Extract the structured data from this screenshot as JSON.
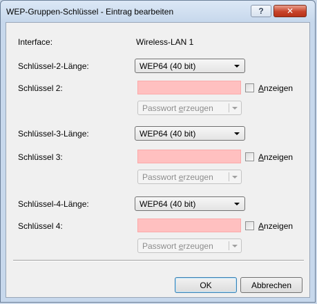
{
  "window": {
    "title": "WEP-Gruppen-Schlüssel - Eintrag bearbeiten",
    "help_label": "?",
    "close_label": "✕"
  },
  "interface": {
    "label": "Interface:",
    "value": "Wireless-LAN 1"
  },
  "groups": [
    {
      "length_label": "Schlüssel-2-Länge:",
      "length_value": "WEP64 (40 bit)",
      "key_label": "Schlüssel 2:",
      "key_value": "",
      "show_label_pre": "",
      "show_label_accel": "A",
      "show_label_post": "nzeigen",
      "generate_pre": "Passwort ",
      "generate_accel": "e",
      "generate_post": "rzeugen"
    },
    {
      "length_label": "Schlüssel-3-Länge:",
      "length_value": "WEP64 (40 bit)",
      "key_label": "Schlüssel 3:",
      "key_value": "",
      "show_label_pre": "",
      "show_label_accel": "A",
      "show_label_post": "nzeigen",
      "generate_pre": "Passwort ",
      "generate_accel": "e",
      "generate_post": "rzeugen"
    },
    {
      "length_label": "Schlüssel-4-Länge:",
      "length_value": "WEP64 (40 bit)",
      "key_label": "Schlüssel 4:",
      "key_value": "",
      "show_label_pre": "",
      "show_label_accel": "A",
      "show_label_post": "nzeigen",
      "generate_pre": "Passwort ",
      "generate_accel": "e",
      "generate_post": "rzeugen"
    }
  ],
  "buttons": {
    "ok": "OK",
    "cancel": "Abbrechen"
  },
  "colors": {
    "key_field_bg": "#ffc0c0",
    "close_button": "#c7432a"
  }
}
